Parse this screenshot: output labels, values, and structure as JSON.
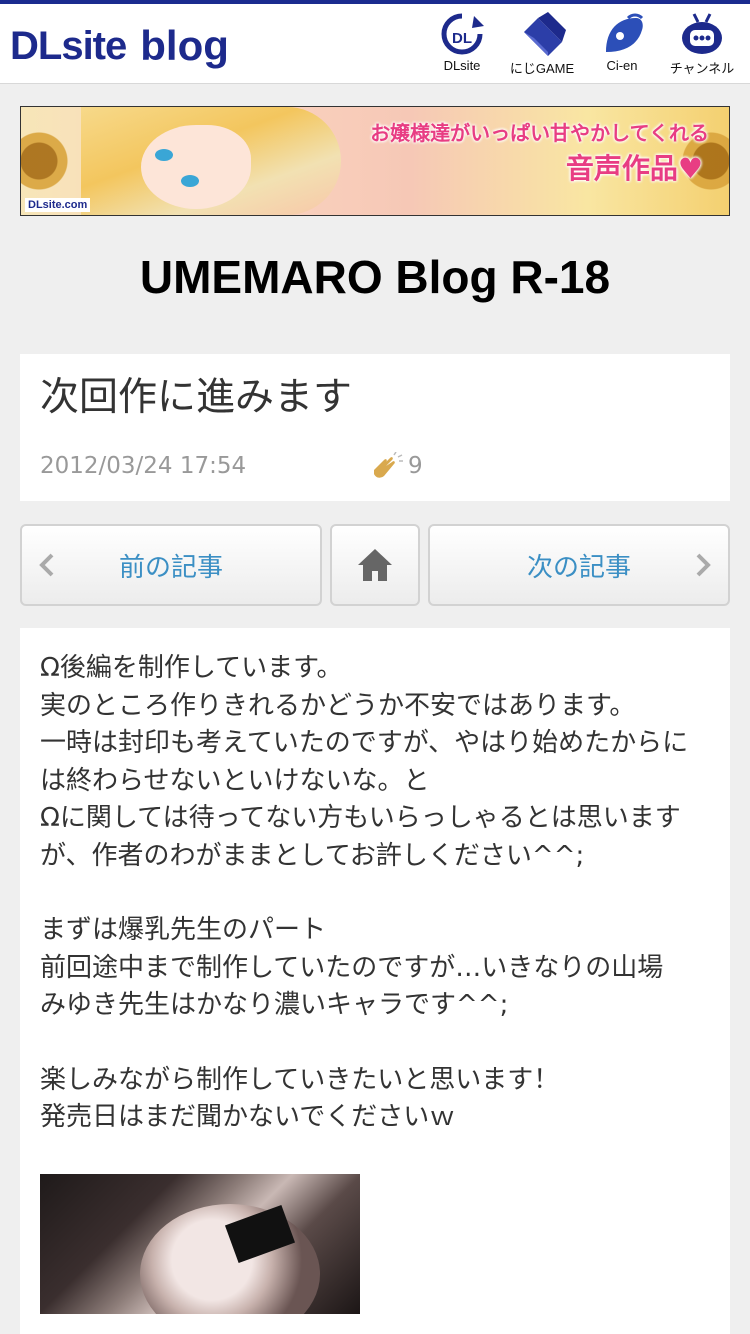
{
  "header": {
    "logo_main": "DLsite",
    "logo_sub": "blog",
    "nav": [
      {
        "label": "DLsite",
        "icon": "dlsite-icon"
      },
      {
        "label": "にじGAME",
        "icon": "nijigame-icon"
      },
      {
        "label": "Ci-en",
        "icon": "cien-icon"
      },
      {
        "label": "チャンネル",
        "icon": "channel-icon"
      }
    ]
  },
  "banner": {
    "copy_line1": "お嬢様達がいっぱい甘やかしてくれる",
    "copy_line2": "音声作品♥",
    "brand": "DLsite.com"
  },
  "blog": {
    "title": "UMEMARO Blog R-18"
  },
  "post": {
    "title": "次回作に進みます",
    "date": "2012/03/24 17:54",
    "clap_count": "9",
    "paragraphs": [
      "Ω後編を制作しています。\n実のところ作りきれるかどうか不安ではあります。\n一時は封印も考えていたのですが、やはり始めたからには終わらせないといけないな。と\nΩに関しては待ってない方もいらっしゃるとは思いますが、作者のわがままとしてお許しください^^;",
      "まずは爆乳先生のパート\n前回途中まで制作していたのですが…いきなりの山場\nみゆき先生はかなり濃いキャラです^^;",
      "楽しみながら制作していきたいと思います！\n発売日はまだ聞かないでくださいｗ"
    ]
  },
  "navigation": {
    "prev_label": "前の記事",
    "next_label": "次の記事"
  },
  "colors": {
    "brand_blue": "#1d2a8c",
    "link_blue": "#3b8fc4",
    "banner_pink": "#e83d83"
  }
}
